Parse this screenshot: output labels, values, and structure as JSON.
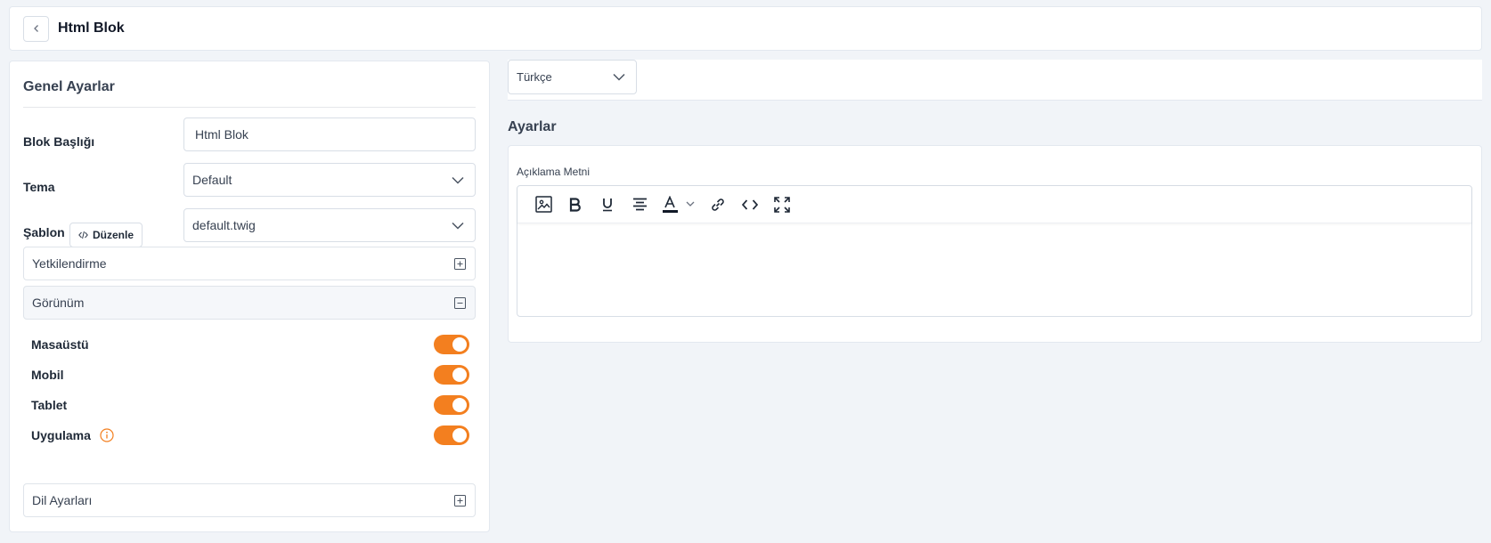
{
  "header": {
    "title": "Html Blok"
  },
  "general": {
    "title": "Genel Ayarlar",
    "block_title_label": "Blok Başlığı",
    "block_title_value": "Html Blok",
    "theme_label": "Tema",
    "theme_value": "Default",
    "template_label": "Şablon",
    "edit_button": "Düzenle",
    "template_value": "default.twig",
    "authorization_label": "Yetkilendirme",
    "appearance_label": "Görünüm",
    "language_settings_label": "Dil Ayarları"
  },
  "visibility": [
    {
      "label": "Masaüstü",
      "enabled": true
    },
    {
      "label": "Mobil",
      "enabled": true
    },
    {
      "label": "Tablet",
      "enabled": true
    },
    {
      "label": "Uygulama",
      "enabled": true,
      "info_icon": "info-icon"
    }
  ],
  "language": {
    "selected": "Türkçe"
  },
  "settings": {
    "title": "Ayarlar",
    "description_label": "Açıklama Metni",
    "toolbar": [
      "image-icon",
      "bold-icon",
      "underline-icon",
      "align-center-icon",
      "text-color-icon",
      "link-icon",
      "code-icon",
      "fullscreen-icon"
    ]
  },
  "colors": {
    "accent": "#f37f1f",
    "background": "#f1f4f8"
  }
}
